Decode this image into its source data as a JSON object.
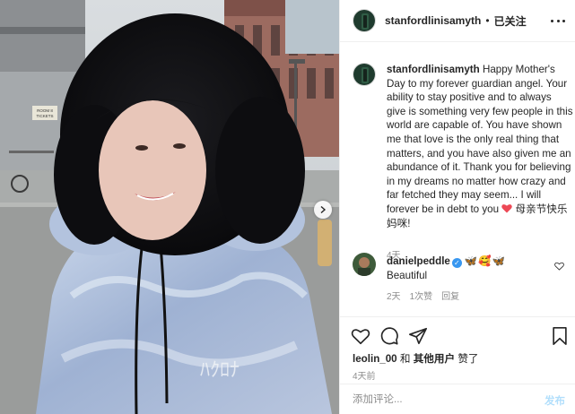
{
  "post": {
    "username": "stanfordlinisamyth",
    "separator": "•",
    "follow_status": "已关注",
    "caption_text": "Happy Mother's Day to my forever guardian angel. Your ability to stay positive and to always give is something very few people in this world are capable of. You have shown me that love is the only real thing that matters, and you have also given me an abundance of it. Thank you for believing in my dreams no matter how crazy and far fetched they may seem... I will forever be in debt to you",
    "caption_tail": "母亲节快乐妈咪!",
    "caption_age": "4天",
    "photo_sign_text": "ROOM 8\nTICKETS"
  },
  "comment": {
    "username": "danielpeddle",
    "verified_mark": "✓",
    "emojis": "🦋🥰🦋",
    "text": "Beautiful",
    "age": "2天",
    "likes": "1次赞",
    "reply": "回复"
  },
  "engagement": {
    "liked_by_user": "leolin_00",
    "and": "和",
    "others": "其他用户",
    "liked_suffix": "赞了",
    "age": "4天前"
  },
  "composer": {
    "placeholder": "添加评论...",
    "post_label": "发布"
  },
  "colors": {
    "link_blue": "#3897f0",
    "post_disabled": "#b2dffc",
    "heart_red": "#ed4956",
    "meta_gray": "#8e8e8e"
  },
  "icons": [
    "heart-icon",
    "comment-icon",
    "share-icon",
    "bookmark-icon",
    "more-options-icon",
    "next-arrow-icon"
  ]
}
